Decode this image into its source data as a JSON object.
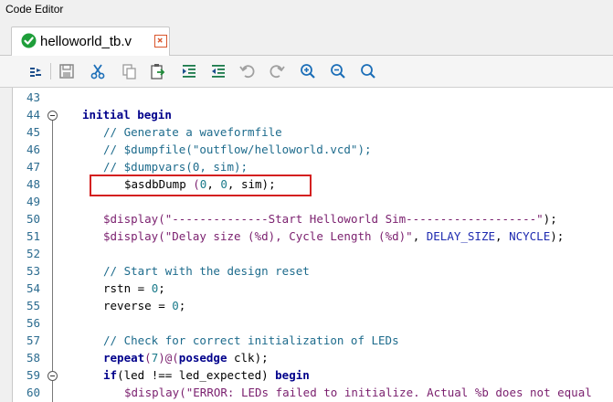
{
  "window": {
    "title": "Code Editor"
  },
  "tab": {
    "label": "helloworld_tb.v",
    "status_icon": "check-circle-icon",
    "close_icon": "close-icon"
  },
  "toolbar": {
    "icons": [
      "indent-tool-icon",
      "save-icon",
      "cut-icon",
      "copy-icon",
      "paste-icon",
      "indent-icon",
      "outdent-icon",
      "undo-icon",
      "redo-icon",
      "zoom-in-icon",
      "zoom-out-icon",
      "find-icon"
    ]
  },
  "colors": {
    "keyword": "#00008b",
    "comment": "#1d6b8c",
    "string": "#7a1f6e",
    "number": "#1a7a8a",
    "highlight_box": "#d42020"
  },
  "editor": {
    "lines": [
      {
        "num": "43"
      },
      {
        "num": "44",
        "kw1": "initial",
        "sp": " ",
        "kw2": "begin"
      },
      {
        "num": "45",
        "comment": "// Generate a waveformfile"
      },
      {
        "num": "46",
        "comment": "// $dumpfile(\"outflow/helloworld.vcd\");"
      },
      {
        "num": "47",
        "comment": "// $dumpvars(0, sim);"
      },
      {
        "num": "48",
        "task": "$asdbDump",
        "p1": " (",
        "n1": "0",
        "c1": ", ",
        "n2": "0",
        "rest": ", sim);"
      },
      {
        "num": "49"
      },
      {
        "num": "50",
        "task": "$display",
        "p1": "(",
        "str": "\"--------------Start Helloworld Sim-------------------\"",
        "rest": ");"
      },
      {
        "num": "51",
        "task": "$display",
        "p1": "(",
        "str": "\"Delay size (%d), Cycle Length (%d)\"",
        "c1": ", ",
        "const1": "DELAY_SIZE",
        "c2": ", ",
        "const2": "NCYCLE",
        "rest": ");"
      },
      {
        "num": "52"
      },
      {
        "num": "53",
        "comment": "// Start with the design reset"
      },
      {
        "num": "54",
        "ident": "rstn = ",
        "n1": "0",
        "rest": ";"
      },
      {
        "num": "55",
        "ident": "reverse = ",
        "n1": "0",
        "rest": ";"
      },
      {
        "num": "56"
      },
      {
        "num": "57",
        "comment": "// Check for correct initialization of LEDs"
      },
      {
        "num": "58",
        "kw1": "repeat",
        "p1": "(",
        "n1": "7",
        "p2": ")@(",
        "kw2": "posedge",
        "rest": " clk);"
      },
      {
        "num": "59",
        "kw1": "if",
        "rest": "(led !== led_expected) ",
        "kw2": "begin"
      },
      {
        "num": "60",
        "task": "$display",
        "p1": "(",
        "str": "\"ERROR: LEDs failed to initialize. Actual %b does not equal"
      }
    ]
  }
}
